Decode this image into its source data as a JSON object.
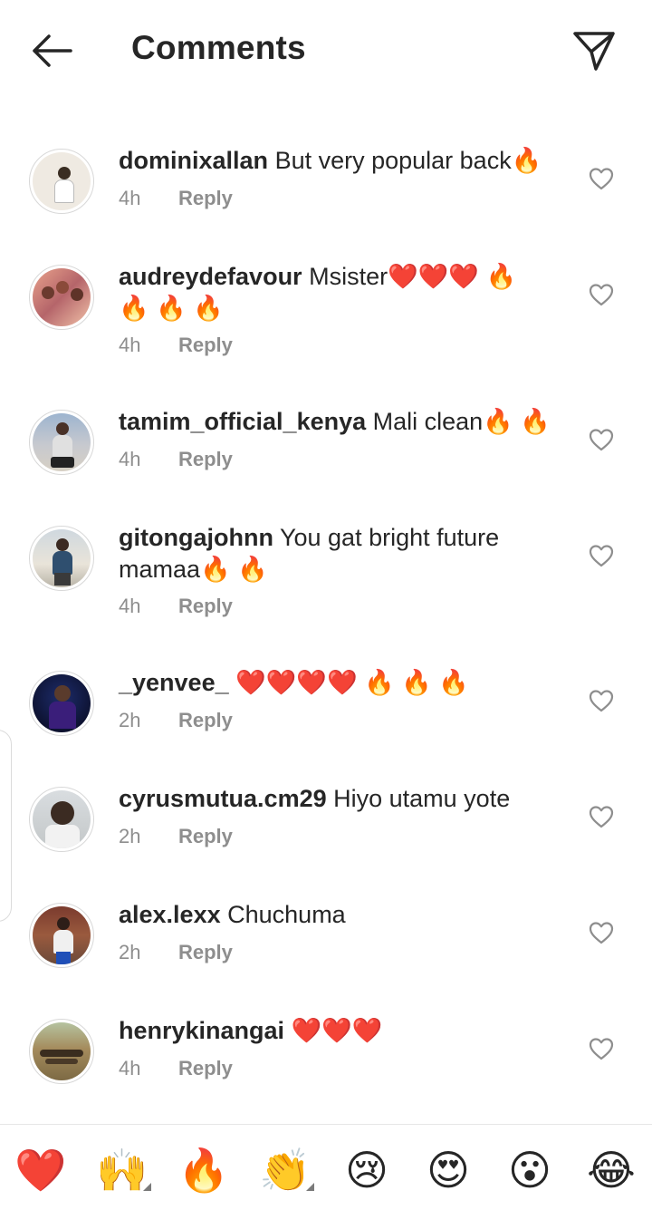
{
  "header": {
    "title": "Comments",
    "back_icon": "arrow-left-icon",
    "send_icon": "paper-plane-icon"
  },
  "comments": [
    {
      "username": "dominixallan",
      "text": "But very popular back🔥",
      "time": "4h",
      "reply": "Reply"
    },
    {
      "username": "audreydefavour",
      "text": "Msister❤️❤️❤️ 🔥 🔥 🔥 🔥",
      "time": "4h",
      "reply": "Reply"
    },
    {
      "username": "tamim_official_kenya",
      "text": "Mali clean🔥 🔥",
      "time": "4h",
      "reply": "Reply"
    },
    {
      "username": "gitongajohnn",
      "text": "You gat bright future mamaa🔥 🔥",
      "time": "4h",
      "reply": "Reply"
    },
    {
      "username": "_yenvee_",
      "text": "❤️❤️❤️❤️ 🔥 🔥 🔥",
      "time": "2h",
      "reply": "Reply"
    },
    {
      "username": "cyrusmutua.cm29",
      "text": "Hiyo utamu yote",
      "time": "2h",
      "reply": "Reply"
    },
    {
      "username": "alex.lexx",
      "text": "Chuchuma",
      "time": "2h",
      "reply": "Reply"
    },
    {
      "username": "henrykinangai",
      "text": "❤️❤️❤️",
      "time": "4h",
      "reply": "Reply"
    }
  ],
  "emoji_bar": [
    "❤️",
    "🙌",
    "🔥",
    "👏",
    "😢",
    "😍",
    "😮",
    "😂"
  ],
  "colors": {
    "text": "#262626",
    "muted": "#8e8e8e",
    "like_outline": "#8e8e8e",
    "heart": "#e0201f"
  }
}
